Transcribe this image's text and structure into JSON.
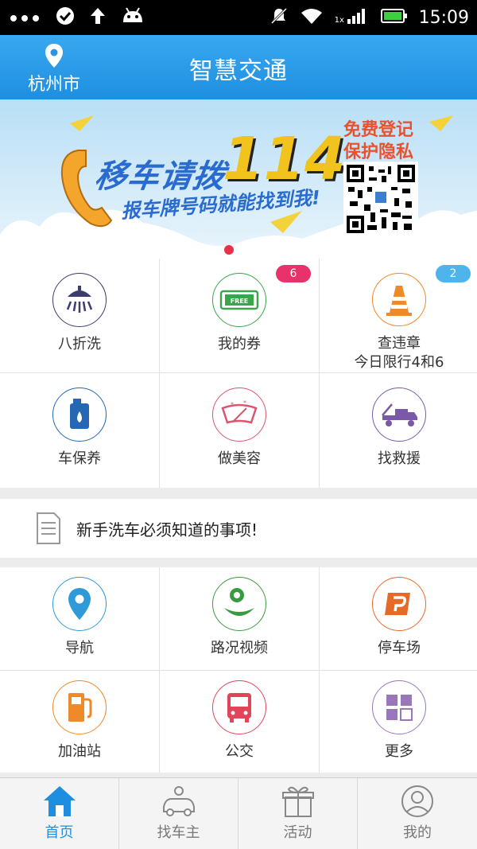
{
  "status_bar": {
    "time": "15:09",
    "network_label": "1x"
  },
  "header": {
    "city": "杭州市",
    "title": "智慧交通"
  },
  "banner": {
    "headline": "移车请拨",
    "number": "114",
    "subline": "报车牌号码就能找到我!",
    "register_line1": "免费登记",
    "register_line2": "保护隐私",
    "page_count": 2,
    "active_page": 1
  },
  "services": [
    {
      "label": "八折洗",
      "icon": "shower-icon",
      "color": "#3c3c6e"
    },
    {
      "label": "我的券",
      "icon": "coupon-icon",
      "color": "#3aa54a",
      "badge": "6",
      "badge_color": "#e8326b"
    },
    {
      "label": "查违章",
      "label2": "今日限行4和6",
      "icon": "traffic-cone-icon",
      "color": "#ee8a2a",
      "badge": "2",
      "badge_color": "#4fb3ec"
    },
    {
      "label": "车保养",
      "icon": "oil-can-icon",
      "color": "#2567b4"
    },
    {
      "label": "做美容",
      "icon": "windshield-icon",
      "color": "#d9566e"
    },
    {
      "label": "找救援",
      "icon": "tow-truck-icon",
      "color": "#7a5aa8"
    }
  ],
  "tip": {
    "text": "新手洗车必须知道的事项!"
  },
  "tools": [
    {
      "label": "导航",
      "icon": "location-pin-icon",
      "color": "#2e9ad8"
    },
    {
      "label": "路况视频",
      "icon": "camera-icon",
      "color": "#3a9a3e"
    },
    {
      "label": "停车场",
      "icon": "parking-icon",
      "color": "#e6692a"
    },
    {
      "label": "加油站",
      "icon": "gas-pump-icon",
      "color": "#ee8a2a"
    },
    {
      "label": "公交",
      "icon": "bus-icon",
      "color": "#e0455a"
    },
    {
      "label": "更多",
      "icon": "more-grid-icon",
      "color": "#9a76bb"
    }
  ],
  "bottom_nav": [
    {
      "label": "首页",
      "icon": "home-icon",
      "active": true
    },
    {
      "label": "找车主",
      "icon": "car-owner-icon",
      "active": false
    },
    {
      "label": "活动",
      "icon": "gift-icon",
      "active": false
    },
    {
      "label": "我的",
      "icon": "profile-icon",
      "active": false
    }
  ],
  "colors": {
    "header_blue": "#1e8fe0",
    "accent_red": "#e8324b"
  }
}
